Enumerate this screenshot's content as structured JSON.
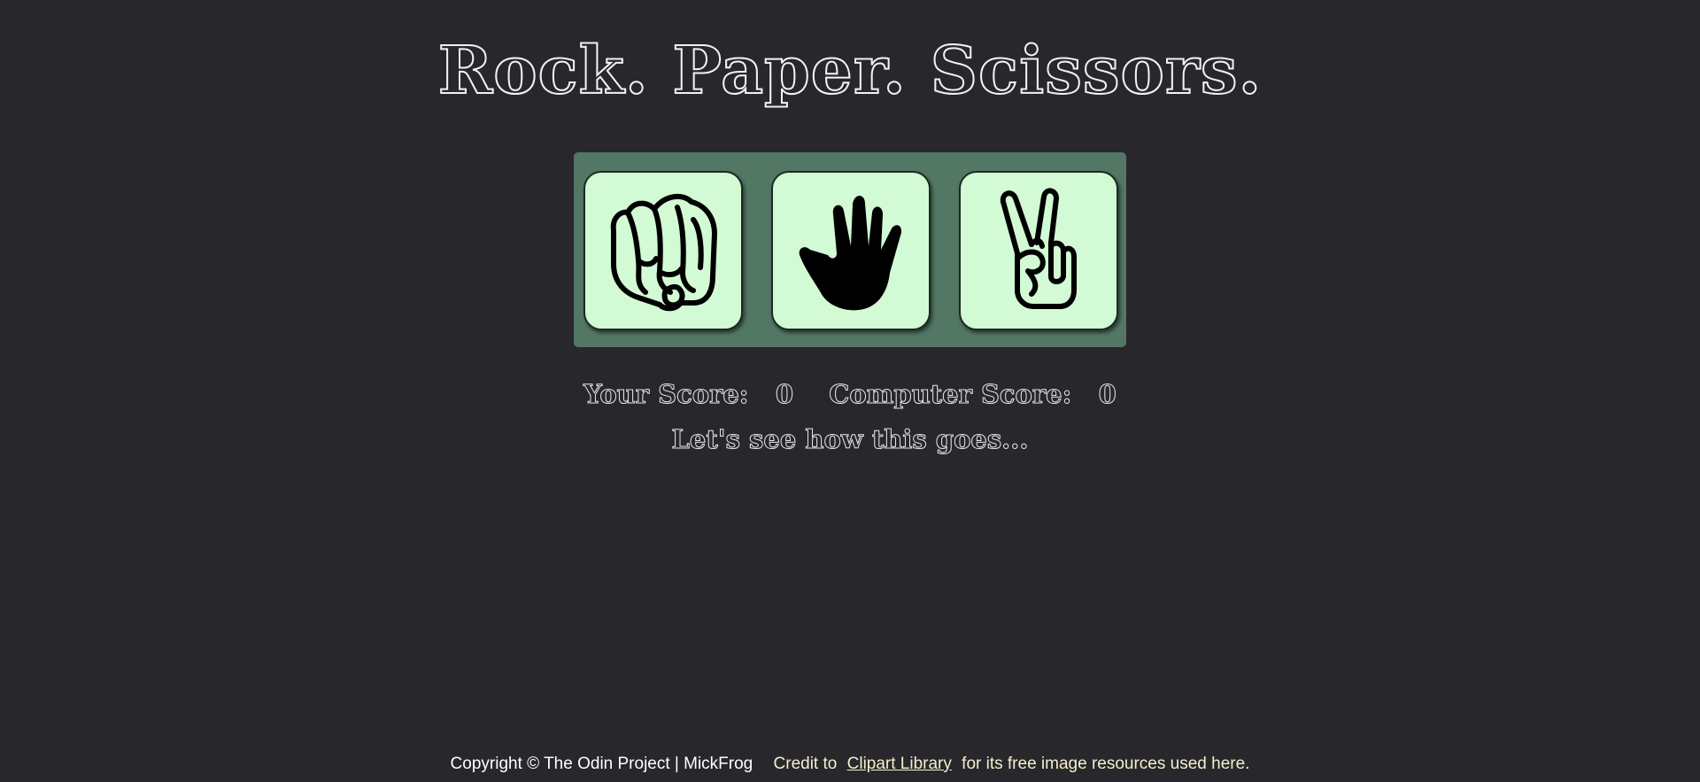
{
  "title": "Rock. Paper. Scissors.",
  "choices": [
    {
      "id": "rock",
      "icon": "rock-fist-icon"
    },
    {
      "id": "paper",
      "icon": "paper-hand-icon"
    },
    {
      "id": "scissors",
      "icon": "scissors-peace-icon"
    }
  ],
  "scores": {
    "player_label": "Your Score:",
    "player_value": "0",
    "computer_label": "Computer Score:",
    "computer_value": "0"
  },
  "message": "Let's see how this goes...",
  "footer": {
    "copyright": "Copyright © The Odin Project | MickFrog",
    "credit_prefix": "Credit to",
    "credit_link": " Clipart Library",
    "credit_suffix": "for its free image resources used here."
  },
  "colors": {
    "background": "#28272c",
    "board": "#527865",
    "card": "#d2fad4",
    "footer_credit": "#f3efc9"
  }
}
